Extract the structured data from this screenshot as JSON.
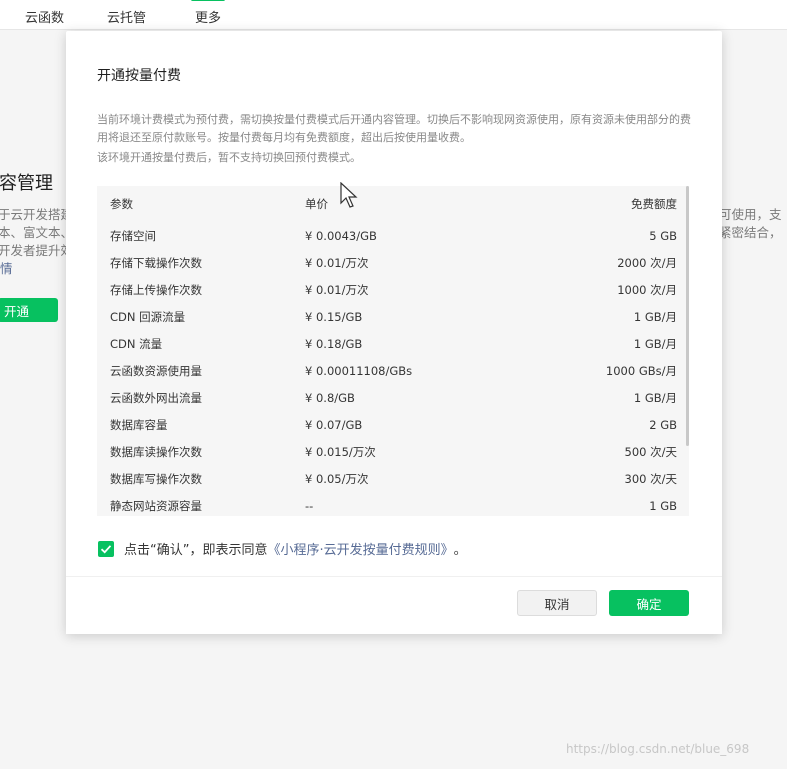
{
  "nav": {
    "tabs": [
      {
        "label": "云函数"
      },
      {
        "label": "云托管"
      },
      {
        "label": "更多"
      }
    ]
  },
  "background": {
    "title": "容管理",
    "left_lines": [
      "于云开发搭建",
      "本、富文本、",
      "开发者提升效"
    ],
    "right_lines": [
      "可使用，支",
      "紧密结合，"
    ],
    "link": "情",
    "open_button": "开通"
  },
  "modal": {
    "title": "开通按量付费",
    "desc": "当前环境计费模式为预付费，需切换按量付费模式后开通内容管理。切换后不影响现网资源使用，原有资源未使用部分的费用将退还至原付款账号。按量付费每月均有免费额度，超出后按使用量收费。",
    "note": "该环境开通按量付费后，暂不支持切换回预付费模式。",
    "table": {
      "headers": [
        "参数",
        "单价",
        "免费额度"
      ],
      "rows": [
        [
          "存储空间",
          "¥ 0.0043/GB",
          "5 GB"
        ],
        [
          "存储下载操作次数",
          "¥ 0.01/万次",
          "2000 次/月"
        ],
        [
          "存储上传操作次数",
          "¥ 0.01/万次",
          "1000 次/月"
        ],
        [
          "CDN 回源流量",
          "¥ 0.15/GB",
          "1 GB/月"
        ],
        [
          "CDN 流量",
          "¥ 0.18/GB",
          "1 GB/月"
        ],
        [
          "云函数资源使用量",
          "¥ 0.00011108/GBs",
          "1000 GBs/月"
        ],
        [
          "云函数外网出流量",
          "¥ 0.8/GB",
          "1 GB/月"
        ],
        [
          "数据库容量",
          "¥ 0.07/GB",
          "2 GB"
        ],
        [
          "数据库读操作次数",
          "¥ 0.015/万次",
          "500 次/天"
        ],
        [
          "数据库写操作次数",
          "¥ 0.05/万次",
          "300 次/天"
        ],
        [
          "静态网站资源容量",
          "--",
          "1 GB"
        ]
      ]
    },
    "agree_prefix": "点击“确认”，即表示同意",
    "agree_link": "《小程序·云开发按量付费规则》",
    "agree_suffix": "。",
    "agree_checked": true,
    "cancel_label": "取消",
    "confirm_label": "确定"
  },
  "watermark": "https://blog.csdn.net/blue_698",
  "colors": {
    "accent": "#07c160",
    "link": "#576b95"
  }
}
